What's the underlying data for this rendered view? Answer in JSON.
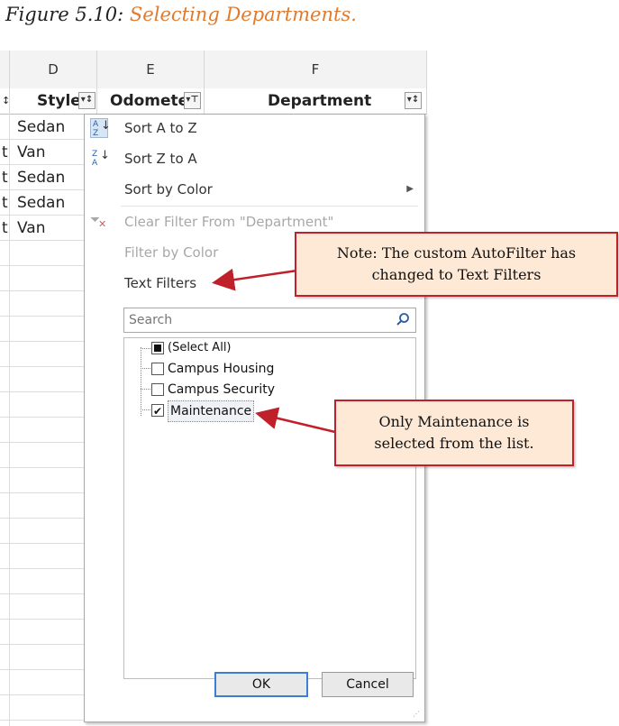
{
  "caption": {
    "prefix": "Figure 5.10:",
    "title": "Selecting Departments."
  },
  "sheet": {
    "columns": [
      "D",
      "E",
      "F"
    ],
    "headers": {
      "left_fragment": "t",
      "style": "Style",
      "odometer": "Odomete",
      "department": "Department"
    },
    "rows": [
      {
        "prefix": "",
        "style": "Sedan"
      },
      {
        "prefix": "t",
        "style": "Van"
      },
      {
        "prefix": "t",
        "style": "Sedan"
      },
      {
        "prefix": "t",
        "style": "Sedan"
      },
      {
        "prefix": "t",
        "style": "Van"
      }
    ]
  },
  "menu": {
    "sort_az": "Sort A to Z",
    "sort_za": "Sort Z to A",
    "sort_by_color": "Sort by Color",
    "clear_filter": "Clear Filter From \"Department\"",
    "filter_by_color": "Filter by Color",
    "text_filters": "Text Filters",
    "search_placeholder": "Search",
    "list": [
      {
        "label": "(Select All)",
        "state": "partial"
      },
      {
        "label": "Campus Housing",
        "state": "unchecked"
      },
      {
        "label": "Campus Security",
        "state": "unchecked"
      },
      {
        "label": "Maintenance",
        "state": "checked"
      }
    ],
    "ok": "OK",
    "cancel": "Cancel"
  },
  "callouts": {
    "note": [
      "Note: The custom AutoFilter has",
      "changed to Text Filters"
    ],
    "maintenance": [
      "Only Maintenance is",
      "selected from the list."
    ]
  },
  "colors": {
    "caption_accent": "#e07a2c",
    "callout_fill": "#fde9d6",
    "callout_border": "#c0202a",
    "ok_border": "#3a7fd5"
  },
  "icons": {
    "sort_az": "sort-az-icon",
    "sort_za": "sort-za-icon",
    "clear_filter": "clear-filter-icon",
    "search": "magnifier-icon"
  }
}
